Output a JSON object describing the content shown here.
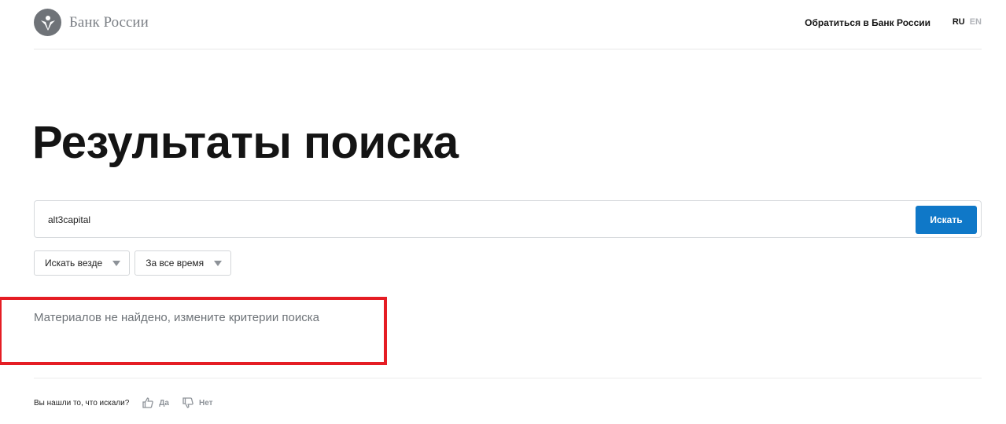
{
  "header": {
    "logo_text": "Банк России",
    "contact_link": "Обратиться в Банк России",
    "lang_ru": "RU",
    "lang_en": "EN"
  },
  "main": {
    "title": "Результаты поиска",
    "search": {
      "value": "alt3capital",
      "button_label": "Искать"
    },
    "filters": {
      "scope": "Искать везде",
      "period": "За все время"
    },
    "no_results_text": "Материалов не найдено, измените критерии поиска"
  },
  "feedback": {
    "question": "Вы нашли то, что искали?",
    "yes_label": "Да",
    "no_label": "Нет"
  },
  "colors": {
    "accent": "#0f78c8",
    "highlight": "#e51d24"
  },
  "icons": [
    "bank-emblem-icon",
    "chevron-down-icon",
    "thumbs-up-icon",
    "thumbs-down-icon"
  ]
}
